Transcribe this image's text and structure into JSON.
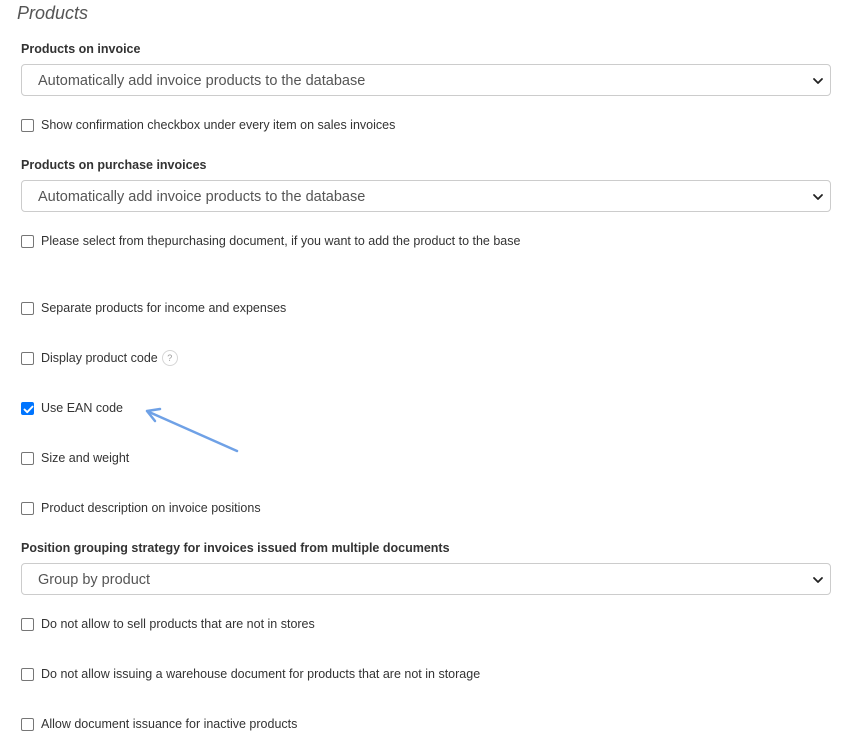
{
  "section": {
    "title": "Products"
  },
  "products_on_invoice": {
    "label": "Products on invoice",
    "selected": "Automatically add invoice products to the database"
  },
  "show_confirmation": {
    "label": "Show confirmation checkbox under every item on sales invoices",
    "checked": false
  },
  "products_on_purchase": {
    "label": "Products on purchase invoices",
    "selected": "Automatically add invoice products to the database"
  },
  "select_from_purchasing": {
    "label": "Please select from thepurchasing document, if you want to add the product to the base",
    "checked": false
  },
  "separate_products": {
    "label": "Separate products for income and expenses",
    "checked": false
  },
  "display_product_code": {
    "label": "Display product code",
    "help": "?",
    "checked": false
  },
  "use_ean_code": {
    "label": "Use EAN code",
    "checked": true
  },
  "size_and_weight": {
    "label": "Size and weight",
    "checked": false
  },
  "product_description": {
    "label": "Product description on invoice positions",
    "checked": false
  },
  "grouping_strategy": {
    "label": "Position grouping strategy for invoices issued from multiple documents",
    "selected": "Group by product"
  },
  "no_sell_not_in_stores": {
    "label": "Do not allow to sell products that are not in stores",
    "checked": false
  },
  "no_warehouse_doc": {
    "label": "Do not allow issuing a warehouse document for products that are not in storage",
    "checked": false
  },
  "inactive_products": {
    "label": "Allow document issuance for inactive products",
    "checked": false
  },
  "colors": {
    "checkbox_checked": "#0075ff",
    "annotation_arrow": "#6fa1e6",
    "border": "#cccccc"
  }
}
